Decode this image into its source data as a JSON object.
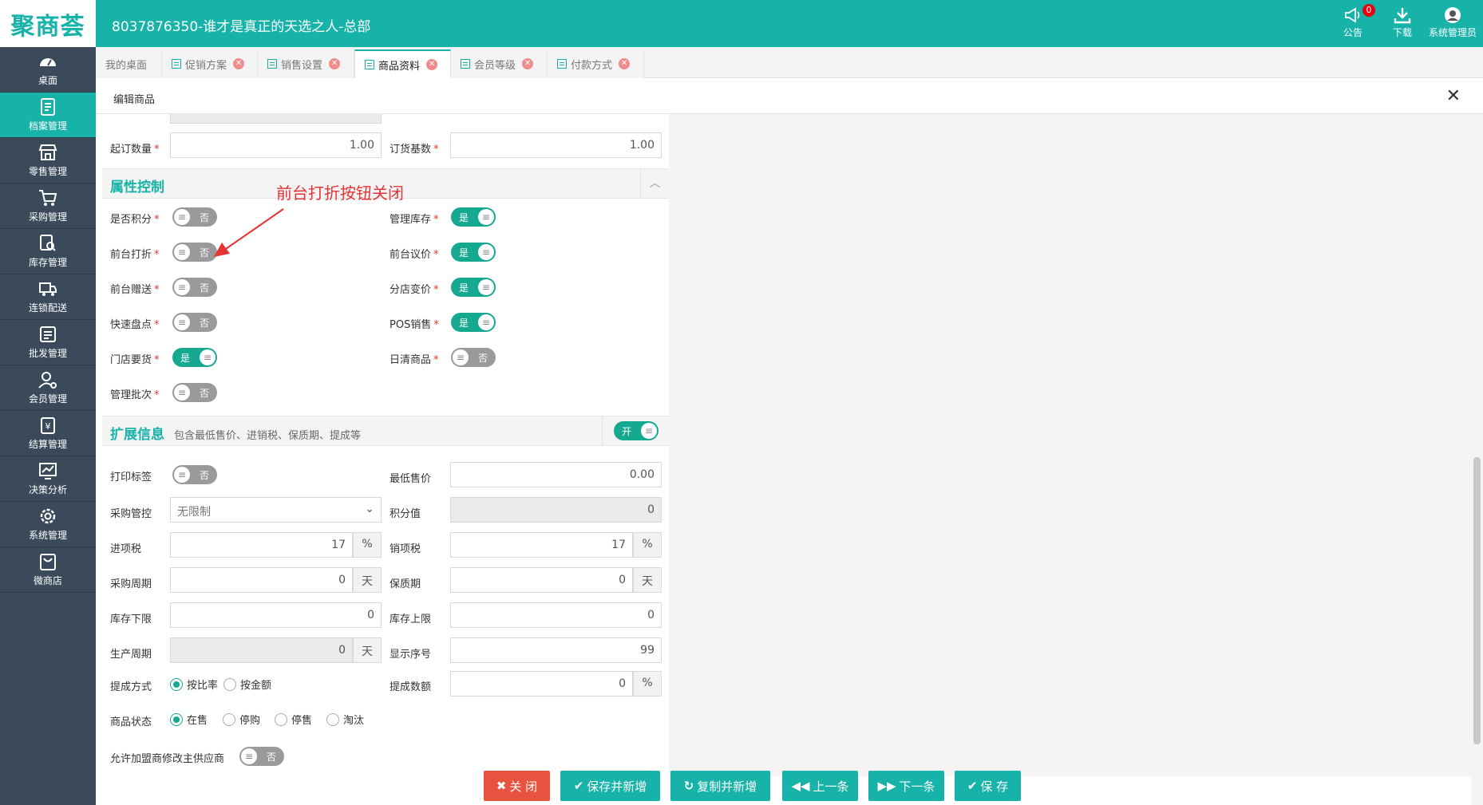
{
  "topbar": {
    "logo_text": "聚商荟",
    "title": "8037876350-谁才是真正的天选之人-总部",
    "notice_label": "公告",
    "notice_badge": "0",
    "download_label": "下载",
    "user_label": "系统管理员"
  },
  "sidebar": {
    "items": [
      {
        "label": "桌面",
        "icon": "dashboard-icon"
      },
      {
        "label": "档案管理",
        "icon": "archive-icon",
        "active": true
      },
      {
        "label": "零售管理",
        "icon": "store-icon"
      },
      {
        "label": "采购管理",
        "icon": "cart-icon"
      },
      {
        "label": "库存管理",
        "icon": "inventory-icon"
      },
      {
        "label": "连锁配送",
        "icon": "truck-icon"
      },
      {
        "label": "批发管理",
        "icon": "wholesale-icon"
      },
      {
        "label": "会员管理",
        "icon": "member-icon"
      },
      {
        "label": "结算管理",
        "icon": "settlement-icon"
      },
      {
        "label": "决策分析",
        "icon": "chart-icon"
      },
      {
        "label": "系统管理",
        "icon": "gear-icon"
      },
      {
        "label": "微商店",
        "icon": "shop-bag-icon"
      }
    ]
  },
  "tabs": [
    {
      "label": "我的桌面"
    },
    {
      "label": "促销方案"
    },
    {
      "label": "销售设置"
    },
    {
      "label": "商品资料",
      "active": true
    },
    {
      "label": "会员等级"
    },
    {
      "label": "付款方式"
    }
  ],
  "dialog": {
    "title": "编辑商品"
  },
  "form": {
    "min_order_label": "起订数量",
    "min_order_value": "1.00",
    "order_base_label": "订货基数",
    "order_base_value": "1.00",
    "attr_section_title": "属性控制",
    "is_points_label": "是否积分",
    "is_points": "否",
    "manage_stock_label": "管理库存",
    "manage_stock": "是",
    "front_discount_label": "前台打折",
    "front_discount": "否",
    "front_bargain_label": "前台议价",
    "front_bargain": "是",
    "front_gift_label": "前台赠送",
    "front_gift": "否",
    "branch_price_label": "分店变价",
    "branch_price": "是",
    "quick_count_label": "快速盘点",
    "quick_count": "否",
    "pos_sale_label": "POS销售",
    "pos_sale": "是",
    "store_request_label": "门店要货",
    "store_request": "是",
    "daily_clear_label": "日清商品",
    "daily_clear": "否",
    "batch_label": "管理批次",
    "batch": "否",
    "ext_section_title": "扩展信息",
    "ext_section_sub": "包含最低售价、进销税、保质期、提成等",
    "ext_toggle": "开",
    "print_label_label": "打印标签",
    "print_label": "否",
    "min_price_label": "最低售价",
    "min_price_value": "0.00",
    "purchase_ctrl_label": "采购管控",
    "purchase_ctrl_value": "无限制",
    "points_value_label": "积分值",
    "points_value": "0",
    "input_tax_label": "进项税",
    "input_tax_value": "17",
    "output_tax_label": "销项税",
    "output_tax_value": "17",
    "percent_unit": "%",
    "purchase_cycle_label": "采购周期",
    "purchase_cycle_value": "0",
    "day_unit": "天",
    "shelf_life_label": "保质期",
    "shelf_life_value": "0",
    "stock_min_label": "库存下限",
    "stock_min_value": "0",
    "stock_max_label": "库存上限",
    "stock_max_value": "0",
    "prod_cycle_label": "生产周期",
    "prod_cycle_value": "0",
    "display_order_label": "显示序号",
    "display_order_value": "99",
    "commission_type_label": "提成方式",
    "commission_by_rate": "按比率",
    "commission_by_amount": "按金额",
    "commission_value_label": "提成数额",
    "commission_value": "0",
    "status_label": "商品状态",
    "status_on_sale": "在售",
    "status_stop_purchase": "停购",
    "status_stop_sale": "停售",
    "status_obsolete": "淘汰",
    "allow_supplier_label": "允许加盟商修改主供应商",
    "allow_supplier": "否"
  },
  "annotation": {
    "text": "前台打折按钮关闭"
  },
  "buttons": {
    "close": "关 闭",
    "save_new": "保存并新增",
    "copy_new": "复制并新增",
    "prev": "上一条",
    "next": "下一条",
    "save": "保 存"
  },
  "colors": {
    "brand": "#17b3a9",
    "toggle_on": "#17a890",
    "toggle_off": "#9a9a9a",
    "danger": "#e8533f",
    "annotation": "#e63333"
  }
}
